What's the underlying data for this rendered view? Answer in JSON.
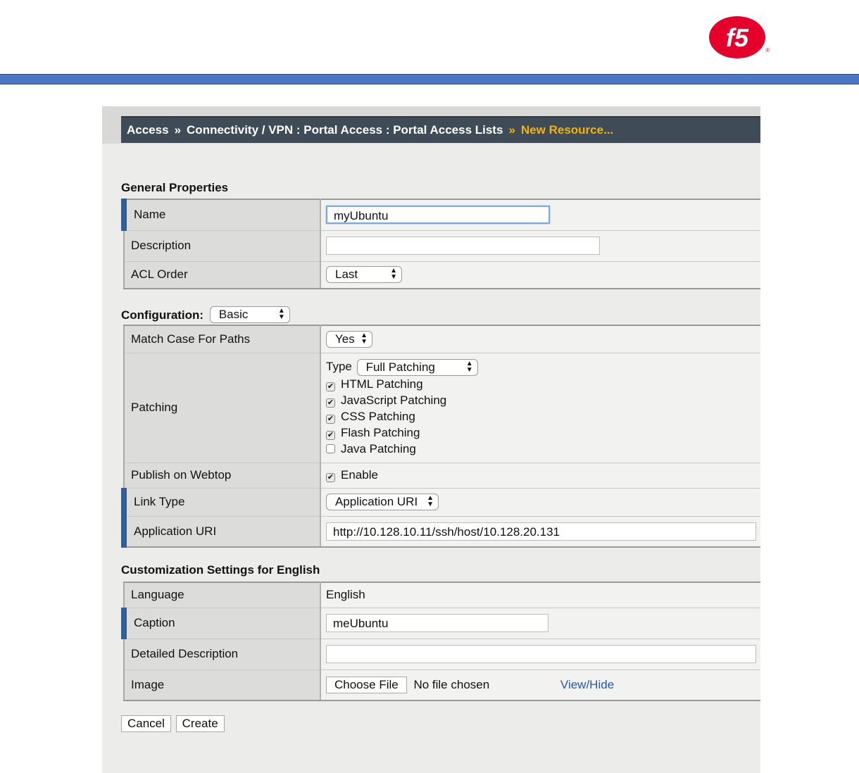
{
  "brand": {
    "logo_text": "f5",
    "registered": "®",
    "bar_color": "#4a78c6"
  },
  "breadcrumb": {
    "items": [
      "Access",
      "Connectivity / VPN : Portal Access : Portal Access Lists"
    ],
    "separator": "»",
    "current": "New Resource..."
  },
  "general": {
    "title": "General Properties",
    "name_label": "Name",
    "name_value": "myUbuntu",
    "description_label": "Description",
    "description_value": "",
    "acl_label": "ACL Order",
    "acl_value": "Last"
  },
  "configuration": {
    "label": "Configuration:",
    "value": "Basic",
    "match_case_label": "Match Case For Paths",
    "match_case_value": "Yes",
    "patching_label": "Patching",
    "type_label": "Type",
    "type_value": "Full Patching",
    "patching_options": [
      {
        "label": "HTML Patching",
        "checked": true
      },
      {
        "label": "JavaScript Patching",
        "checked": true
      },
      {
        "label": "CSS Patching",
        "checked": true
      },
      {
        "label": "Flash Patching",
        "checked": true
      },
      {
        "label": "Java Patching",
        "checked": false
      }
    ],
    "publish_label": "Publish on Webtop",
    "publish_option": "Enable",
    "publish_checked": true,
    "link_type_label": "Link Type",
    "link_type_value": "Application URI",
    "app_uri_label": "Application URI",
    "app_uri_value": "http://10.128.10.11/ssh/host/10.128.20.131"
  },
  "customization": {
    "title": "Customization Settings for English",
    "language_label": "Language",
    "language_value": "English",
    "caption_label": "Caption",
    "caption_value": "meUbuntu",
    "detailed_label": "Detailed Description",
    "detailed_value": "",
    "image_label": "Image",
    "choose_file": "Choose File",
    "no_file": "No file chosen",
    "view_hide": "View/Hide"
  },
  "buttons": {
    "cancel": "Cancel",
    "create": "Create"
  }
}
